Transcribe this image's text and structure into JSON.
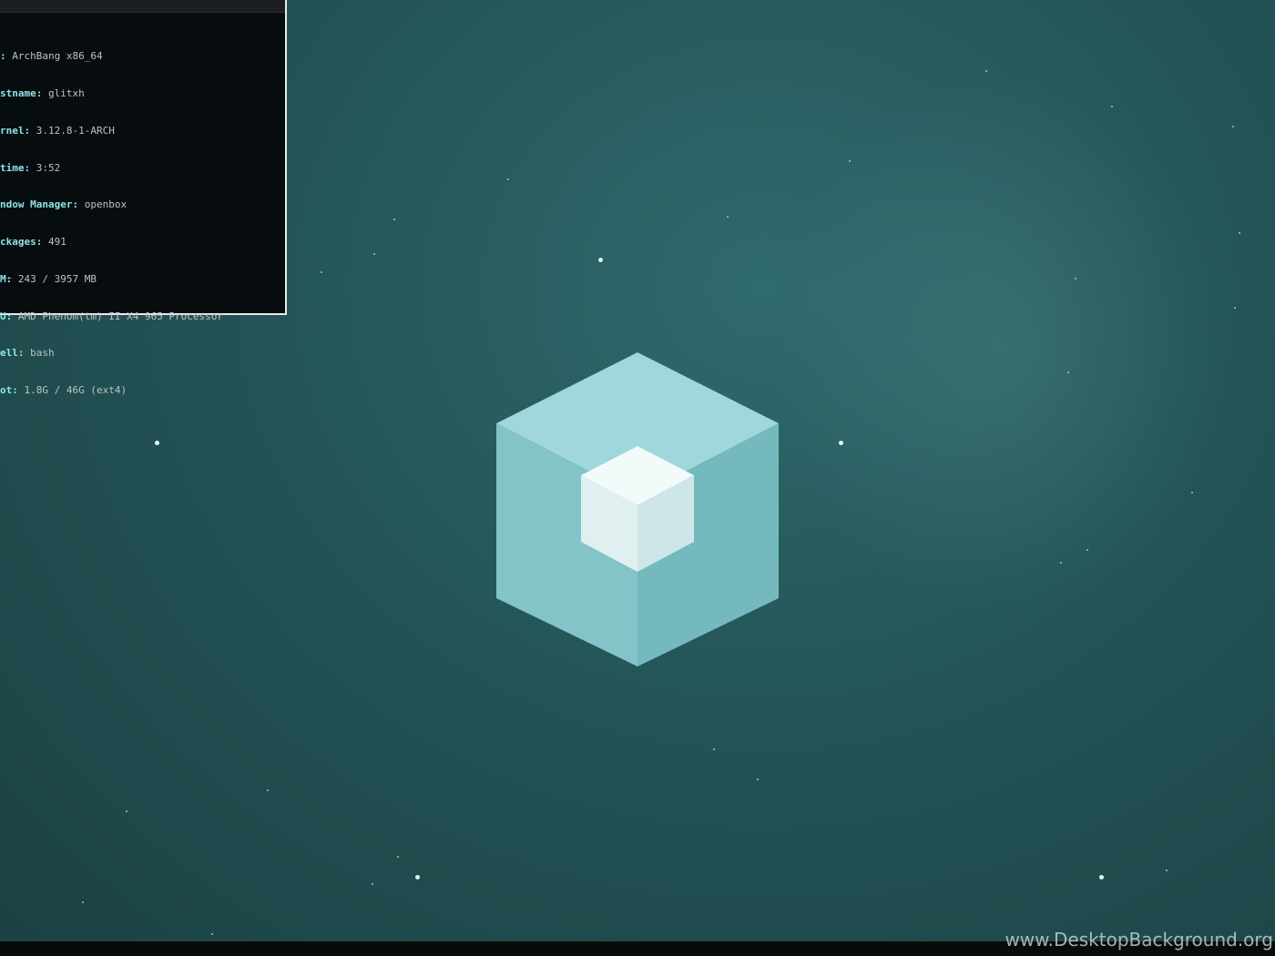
{
  "terminal": {
    "lines": [
      {
        "key": ":",
        "value": " ArchBang x86_64"
      },
      {
        "key": "stname:",
        "value": " glitxh"
      },
      {
        "key": "rnel:",
        "value": " 3.12.8-1-ARCH"
      },
      {
        "key": "time:",
        "value": " 3:52"
      },
      {
        "key": "ndow Manager:",
        "value": " openbox"
      },
      {
        "key": "ckages:",
        "value": " 491"
      },
      {
        "key": "M:",
        "value": " 243 / 3957 MB"
      },
      {
        "key": "U:",
        "value": " AMD Phenom(tm) II X4 965 Processor"
      },
      {
        "key": "ell:",
        "value": " bash"
      },
      {
        "key": "ot:",
        "value": " 1.8G / 46G (ext4)"
      }
    ],
    "cursor": "_"
  },
  "wallpaper": {
    "icon": "nested-cube-icon",
    "colors": {
      "background": "#245457",
      "cube_outer": "#8fd0d3",
      "cube_inner": "#e4f3f3"
    }
  },
  "watermark": "www.DesktopBackground.org"
}
